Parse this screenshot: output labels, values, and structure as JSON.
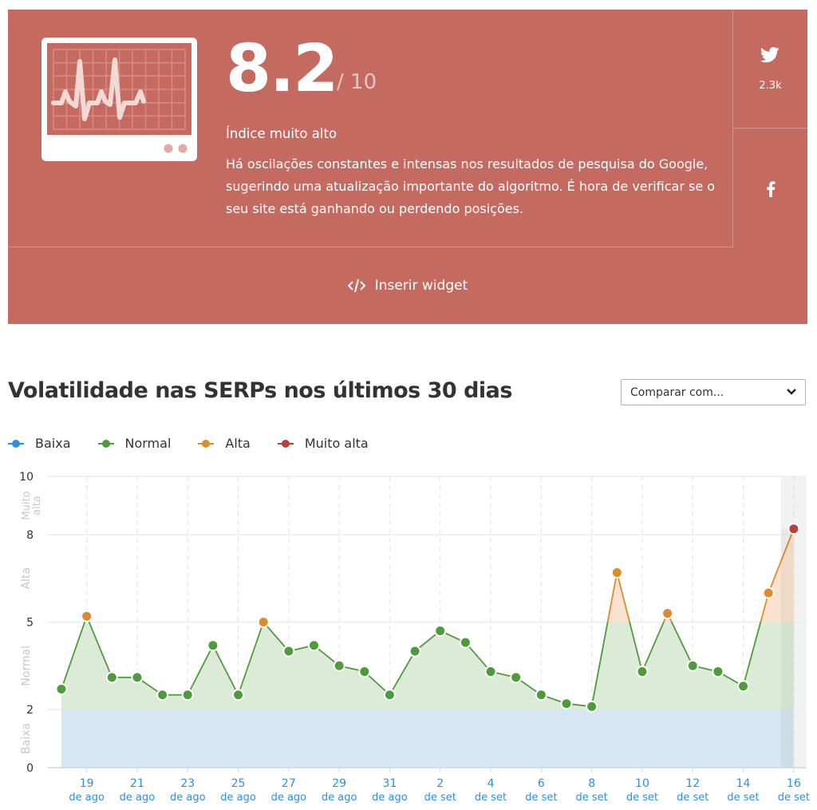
{
  "score_panel": {
    "score": "8.2",
    "score_max": "/ 10",
    "status_label": "Índice muito alto",
    "description": "Há oscilações constantes e intensas nos resultados de pesquisa do Google, sugerindo uma atualização importante do algoritmo. É hora de verificar se o seu site está ganhando ou perdendo posições.",
    "icon": "heart-monitor-icon",
    "background_color": "#c56a61",
    "share": {
      "twitter": {
        "icon": "twitter-icon",
        "count": "2.3k"
      },
      "facebook": {
        "icon": "facebook-icon"
      }
    },
    "widget_button": {
      "icon": "code-icon",
      "label": "Inserir widget"
    }
  },
  "chart_section": {
    "title": "Volatilidade nas SERPs nos últimos 30 dias",
    "compare_select": {
      "selected": "Comparar com...",
      "icon": "chevron-down-icon"
    },
    "legend": [
      {
        "label": "Baixa",
        "color": "#2f8fdb"
      },
      {
        "label": "Normal",
        "color": "#4f9a3d"
      },
      {
        "label": "Alta",
        "color": "#e08a2e"
      },
      {
        "label": "Muito alta",
        "color": "#b9413a"
      }
    ]
  },
  "chart_data": {
    "type": "area",
    "title": "Volatilidade nas SERPs nos últimos 30 dias",
    "xlabel": "",
    "ylabel": "",
    "ylim": [
      0,
      10
    ],
    "yticks": [
      0,
      2,
      5,
      8,
      10
    ],
    "bands": [
      {
        "label": "Baixa",
        "from": 0,
        "to": 2,
        "color": "#2f8fdb"
      },
      {
        "label": "Normal",
        "from": 2,
        "to": 5,
        "color": "#4f9a3d"
      },
      {
        "label": "Alta",
        "from": 5,
        "to": 8,
        "color": "#e08a2e"
      },
      {
        "label": "Muito alta",
        "from": 8,
        "to": 10,
        "color": "#b9413a"
      }
    ],
    "x": [
      "18 de ago",
      "19 de ago",
      "20 de ago",
      "21 de ago",
      "22 de ago",
      "23 de ago",
      "24 de ago",
      "25 de ago",
      "26 de ago",
      "27 de ago",
      "28 de ago",
      "29 de ago",
      "30 de ago",
      "31 de ago",
      "1 de set",
      "2 de set",
      "3 de set",
      "4 de set",
      "5 de set",
      "6 de set",
      "7 de set",
      "8 de set",
      "9 de set",
      "10 de set",
      "11 de set",
      "12 de set",
      "13 de set",
      "14 de set",
      "15 de set",
      "16 de set"
    ],
    "xtick_labels": [
      {
        "day": "19",
        "month": "de ago"
      },
      {
        "day": "21",
        "month": "de ago"
      },
      {
        "day": "23",
        "month": "de ago"
      },
      {
        "day": "25",
        "month": "de ago"
      },
      {
        "day": "27",
        "month": "de ago"
      },
      {
        "day": "29",
        "month": "de ago"
      },
      {
        "day": "31",
        "month": "de ago"
      },
      {
        "day": "2",
        "month": "de set"
      },
      {
        "day": "4",
        "month": "de set"
      },
      {
        "day": "6",
        "month": "de set"
      },
      {
        "day": "8",
        "month": "de set"
      },
      {
        "day": "10",
        "month": "de set"
      },
      {
        "day": "12",
        "month": "de set"
      },
      {
        "day": "14",
        "month": "de set"
      },
      {
        "day": "16",
        "month": "de set"
      }
    ],
    "values": [
      2.7,
      5.2,
      3.1,
      3.1,
      2.5,
      2.5,
      4.2,
      2.5,
      5.0,
      4.0,
      4.2,
      3.5,
      3.3,
      2.5,
      4.0,
      4.7,
      4.3,
      3.3,
      3.1,
      2.5,
      2.2,
      2.1,
      6.7,
      3.3,
      5.3,
      3.5,
      3.3,
      2.8,
      6.0,
      8.2
    ],
    "highlighted_day": "16 de set",
    "grid": true,
    "legend_position": "top-left"
  }
}
